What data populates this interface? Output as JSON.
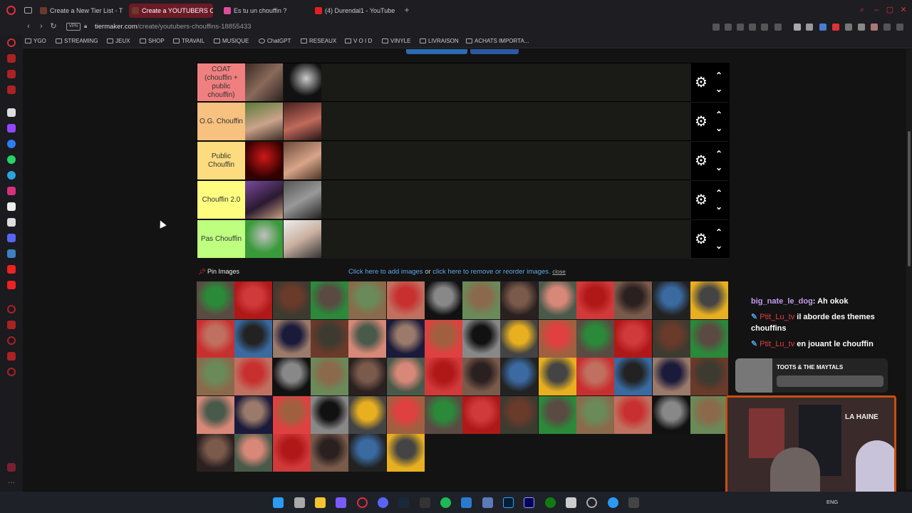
{
  "browser": {
    "tabs": [
      {
        "label": "Create a New Tier List - T",
        "favicon_color": "#6b3a2a",
        "active": false
      },
      {
        "label": "Create a YOUTUBERS CH",
        "favicon_color": "#6b3a2a",
        "active": true
      },
      {
        "label": "Es tu un chouffin ?",
        "favicon_color": "#e04b9c",
        "active": false
      },
      {
        "label": "(4) Durendal1 - YouTube",
        "favicon_color": "#e02020",
        "active": false
      }
    ],
    "new_tab_label": "+",
    "vpn_label": "VPN",
    "url_main": "tiermaker.com",
    "url_path": "/create/youtubers-chouffins-18855433",
    "bookmarks": [
      "YGO",
      "STREAMING",
      "JEUX",
      "SHOP",
      "TRAVAIL",
      "MUSIQUE",
      "ChatGPT",
      "RESEAUX",
      "V O I D",
      "VINYLE",
      "LIVRAISON",
      "ACHATS IMPORTA..."
    ]
  },
  "tierlist": {
    "rows": [
      {
        "label": "COAT (chouffin + public chouffin)",
        "color": "#f08080",
        "items": 2
      },
      {
        "label": "O.G. Chouffin",
        "color": "#f7c17f",
        "items": 2
      },
      {
        "label": "Public Chouffin",
        "color": "#fcdc7f",
        "items": 2
      },
      {
        "label": "Chouffin 2.0",
        "color": "#fffd7f",
        "items": 2
      },
      {
        "label": "Pas Chouffin",
        "color": "#bfff7f",
        "items": 2
      }
    ],
    "settings_icon": "gear-icon",
    "up_icon": "chevron-up-icon",
    "down_icon": "chevron-down-icon"
  },
  "pin": {
    "label": "Pin Images",
    "link_add": "Click here to add images",
    "link_or": " or ",
    "link_remove": "click here to remove or reorder images.",
    "close": "close"
  },
  "pool": {
    "count": 62
  },
  "chat": {
    "messages": [
      {
        "user": "big_nate_le_dog",
        "text": ": Ah okok",
        "user_color": "#c59cf2",
        "pinned": false
      },
      {
        "user": "Ptit_Lu_tv",
        "text": "il aborde des themes chouffins",
        "user_color": "#e43d43",
        "pinned": true
      },
      {
        "user": "Ptit_Lu_tv",
        "text": "en jouant le chouffin",
        "user_color": "#e43d43",
        "pinned": true
      }
    ],
    "now_playing": "TOOTS & THE MAYTALS"
  },
  "webcam": {
    "poster_text": "LA HAINE"
  },
  "taskbar": {
    "language": "ENG"
  }
}
